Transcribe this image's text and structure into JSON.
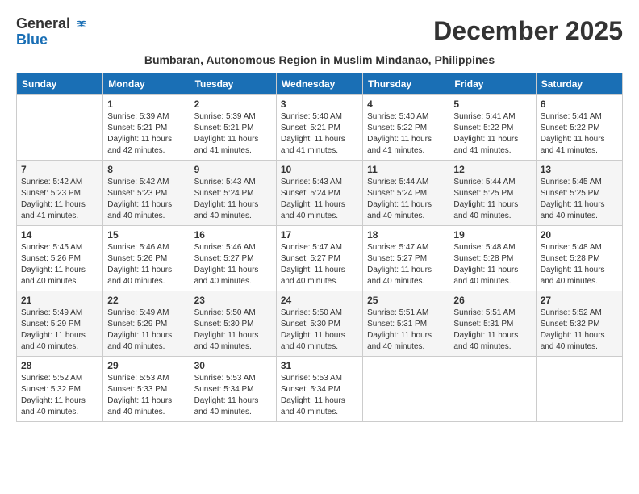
{
  "header": {
    "logo_general": "General",
    "logo_blue": "Blue",
    "month_title": "December 2025",
    "subtitle": "Bumbaran, Autonomous Region in Muslim Mindanao, Philippines"
  },
  "calendar": {
    "days_of_week": [
      "Sunday",
      "Monday",
      "Tuesday",
      "Wednesday",
      "Thursday",
      "Friday",
      "Saturday"
    ],
    "weeks": [
      [
        {
          "day": "",
          "info": ""
        },
        {
          "day": "1",
          "info": "Sunrise: 5:39 AM\nSunset: 5:21 PM\nDaylight: 11 hours\nand 42 minutes."
        },
        {
          "day": "2",
          "info": "Sunrise: 5:39 AM\nSunset: 5:21 PM\nDaylight: 11 hours\nand 41 minutes."
        },
        {
          "day": "3",
          "info": "Sunrise: 5:40 AM\nSunset: 5:21 PM\nDaylight: 11 hours\nand 41 minutes."
        },
        {
          "day": "4",
          "info": "Sunrise: 5:40 AM\nSunset: 5:22 PM\nDaylight: 11 hours\nand 41 minutes."
        },
        {
          "day": "5",
          "info": "Sunrise: 5:41 AM\nSunset: 5:22 PM\nDaylight: 11 hours\nand 41 minutes."
        },
        {
          "day": "6",
          "info": "Sunrise: 5:41 AM\nSunset: 5:22 PM\nDaylight: 11 hours\nand 41 minutes."
        }
      ],
      [
        {
          "day": "7",
          "info": "Sunrise: 5:42 AM\nSunset: 5:23 PM\nDaylight: 11 hours\nand 41 minutes."
        },
        {
          "day": "8",
          "info": "Sunrise: 5:42 AM\nSunset: 5:23 PM\nDaylight: 11 hours\nand 40 minutes."
        },
        {
          "day": "9",
          "info": "Sunrise: 5:43 AM\nSunset: 5:24 PM\nDaylight: 11 hours\nand 40 minutes."
        },
        {
          "day": "10",
          "info": "Sunrise: 5:43 AM\nSunset: 5:24 PM\nDaylight: 11 hours\nand 40 minutes."
        },
        {
          "day": "11",
          "info": "Sunrise: 5:44 AM\nSunset: 5:24 PM\nDaylight: 11 hours\nand 40 minutes."
        },
        {
          "day": "12",
          "info": "Sunrise: 5:44 AM\nSunset: 5:25 PM\nDaylight: 11 hours\nand 40 minutes."
        },
        {
          "day": "13",
          "info": "Sunrise: 5:45 AM\nSunset: 5:25 PM\nDaylight: 11 hours\nand 40 minutes."
        }
      ],
      [
        {
          "day": "14",
          "info": "Sunrise: 5:45 AM\nSunset: 5:26 PM\nDaylight: 11 hours\nand 40 minutes."
        },
        {
          "day": "15",
          "info": "Sunrise: 5:46 AM\nSunset: 5:26 PM\nDaylight: 11 hours\nand 40 minutes."
        },
        {
          "day": "16",
          "info": "Sunrise: 5:46 AM\nSunset: 5:27 PM\nDaylight: 11 hours\nand 40 minutes."
        },
        {
          "day": "17",
          "info": "Sunrise: 5:47 AM\nSunset: 5:27 PM\nDaylight: 11 hours\nand 40 minutes."
        },
        {
          "day": "18",
          "info": "Sunrise: 5:47 AM\nSunset: 5:27 PM\nDaylight: 11 hours\nand 40 minutes."
        },
        {
          "day": "19",
          "info": "Sunrise: 5:48 AM\nSunset: 5:28 PM\nDaylight: 11 hours\nand 40 minutes."
        },
        {
          "day": "20",
          "info": "Sunrise: 5:48 AM\nSunset: 5:28 PM\nDaylight: 11 hours\nand 40 minutes."
        }
      ],
      [
        {
          "day": "21",
          "info": "Sunrise: 5:49 AM\nSunset: 5:29 PM\nDaylight: 11 hours\nand 40 minutes."
        },
        {
          "day": "22",
          "info": "Sunrise: 5:49 AM\nSunset: 5:29 PM\nDaylight: 11 hours\nand 40 minutes."
        },
        {
          "day": "23",
          "info": "Sunrise: 5:50 AM\nSunset: 5:30 PM\nDaylight: 11 hours\nand 40 minutes."
        },
        {
          "day": "24",
          "info": "Sunrise: 5:50 AM\nSunset: 5:30 PM\nDaylight: 11 hours\nand 40 minutes."
        },
        {
          "day": "25",
          "info": "Sunrise: 5:51 AM\nSunset: 5:31 PM\nDaylight: 11 hours\nand 40 minutes."
        },
        {
          "day": "26",
          "info": "Sunrise: 5:51 AM\nSunset: 5:31 PM\nDaylight: 11 hours\nand 40 minutes."
        },
        {
          "day": "27",
          "info": "Sunrise: 5:52 AM\nSunset: 5:32 PM\nDaylight: 11 hours\nand 40 minutes."
        }
      ],
      [
        {
          "day": "28",
          "info": "Sunrise: 5:52 AM\nSunset: 5:32 PM\nDaylight: 11 hours\nand 40 minutes."
        },
        {
          "day": "29",
          "info": "Sunrise: 5:53 AM\nSunset: 5:33 PM\nDaylight: 11 hours\nand 40 minutes."
        },
        {
          "day": "30",
          "info": "Sunrise: 5:53 AM\nSunset: 5:34 PM\nDaylight: 11 hours\nand 40 minutes."
        },
        {
          "day": "31",
          "info": "Sunrise: 5:53 AM\nSunset: 5:34 PM\nDaylight: 11 hours\nand 40 minutes."
        },
        {
          "day": "",
          "info": ""
        },
        {
          "day": "",
          "info": ""
        },
        {
          "day": "",
          "info": ""
        }
      ]
    ]
  }
}
